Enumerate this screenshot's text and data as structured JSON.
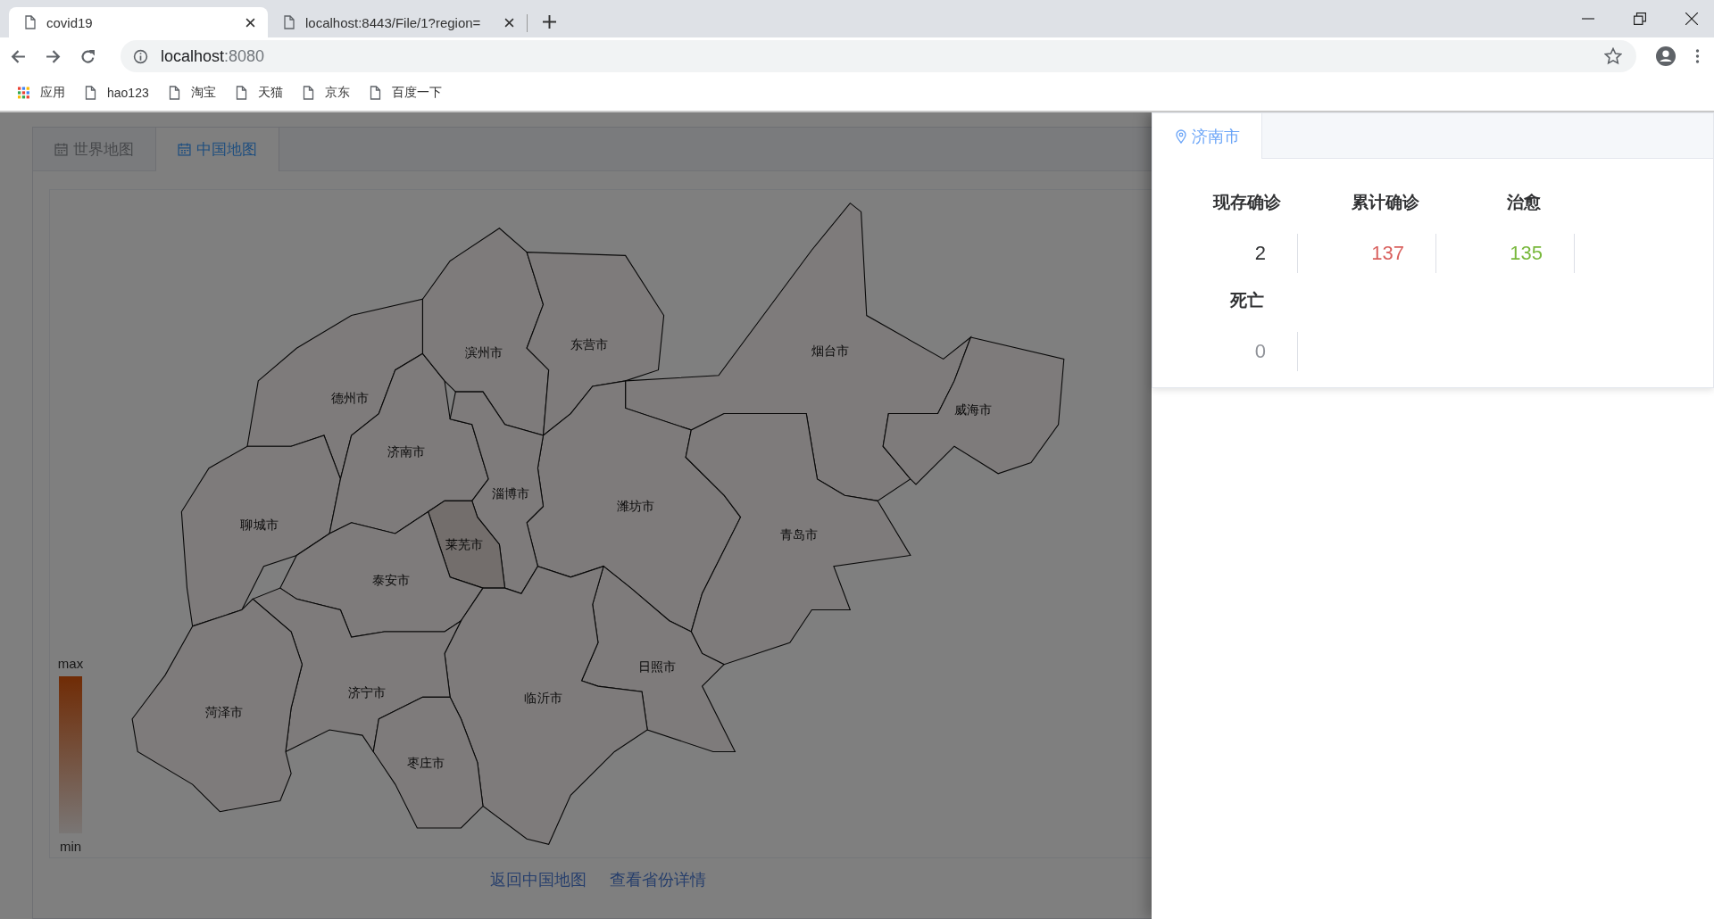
{
  "browser": {
    "tabs": [
      {
        "title": "covid19",
        "selected": true
      },
      {
        "title": "localhost:8443/File/1?region=",
        "selected": false
      }
    ],
    "address": {
      "host": "localhost",
      "port": ":8080"
    },
    "bookmarks": [
      {
        "label": "应用",
        "kind": "apps"
      },
      {
        "label": "hao123",
        "kind": "page"
      },
      {
        "label": "淘宝",
        "kind": "page"
      },
      {
        "label": "天猫",
        "kind": "page"
      },
      {
        "label": "京东",
        "kind": "page"
      },
      {
        "label": "百度一下",
        "kind": "page"
      }
    ]
  },
  "map_tabs": [
    {
      "label": "世界地图",
      "selected": false
    },
    {
      "label": "中国地图",
      "selected": true
    }
  ],
  "map": {
    "legend": {
      "max": "max",
      "min": "min"
    },
    "cities": [
      {
        "name": "德州市",
        "highlighted": false
      },
      {
        "name": "聊城市",
        "highlighted": false
      },
      {
        "name": "济南市",
        "highlighted": false
      },
      {
        "name": "滨州市",
        "highlighted": false
      },
      {
        "name": "东营市",
        "highlighted": false
      },
      {
        "name": "烟台市",
        "highlighted": false
      },
      {
        "name": "威海市",
        "highlighted": false
      },
      {
        "name": "潍坊市",
        "highlighted": false
      },
      {
        "name": "淄博市",
        "highlighted": false
      },
      {
        "name": "莱芜市",
        "highlighted": true
      },
      {
        "name": "泰安市",
        "highlighted": false
      },
      {
        "name": "青岛市",
        "highlighted": false
      },
      {
        "name": "日照市",
        "highlighted": false
      },
      {
        "name": "临沂市",
        "highlighted": false
      },
      {
        "name": "济宁市",
        "highlighted": false
      },
      {
        "name": "菏泽市",
        "highlighted": false
      },
      {
        "name": "枣庄市",
        "highlighted": false
      }
    ]
  },
  "links": [
    "返回中国地图",
    "查看省份详情"
  ],
  "drawer": {
    "tabs": [
      {
        "label": "济南市",
        "selected": true
      }
    ],
    "stats": [
      {
        "label": "现存确诊",
        "value": "2",
        "color": "#303133"
      },
      {
        "label": "累计确诊",
        "value": "137",
        "color": "#d9615e"
      },
      {
        "label": "治愈",
        "value": "135",
        "color": "#78b83c"
      },
      {
        "label": "死亡",
        "value": "0",
        "color": "#909399"
      }
    ]
  }
}
